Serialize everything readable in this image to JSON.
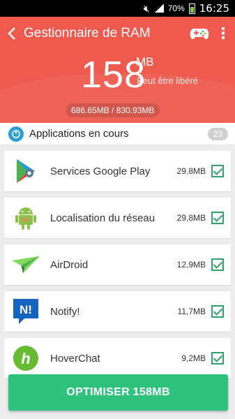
{
  "status_bar": {
    "battery": "70%",
    "time": "16:25"
  },
  "app_bar": {
    "title": "Gestionnaire de RAM"
  },
  "summary": {
    "freeable_value": "158",
    "freeable_unit": "MB",
    "freeable_label": "Peut être libéré",
    "memory_usage": "686.65MB / 830.93MB"
  },
  "section": {
    "title": "Applications en cours",
    "count": "23"
  },
  "apps": [
    {
      "name": "Services Google Play",
      "size": "29,8MB",
      "icon": "google-play-services-icon",
      "checked": true
    },
    {
      "name": "Localisation du réseau",
      "size": "29,8MB",
      "icon": "android-robot-icon",
      "checked": true
    },
    {
      "name": "AirDroid",
      "size": "12,9MB",
      "icon": "airdroid-icon",
      "checked": true
    },
    {
      "name": "Notify!",
      "size": "11,7MB",
      "icon": "notify-icon",
      "checked": true
    },
    {
      "name": "HoverChat",
      "size": "9,2MB",
      "icon": "hoverchat-icon",
      "checked": true
    }
  ],
  "action": {
    "optimize_label": "OPTIMISER 158MB"
  },
  "colors": {
    "header": "#ee5a4f",
    "accent": "#2ec27e",
    "check": "#2fa36a",
    "section_icon": "#2d9fd0"
  }
}
